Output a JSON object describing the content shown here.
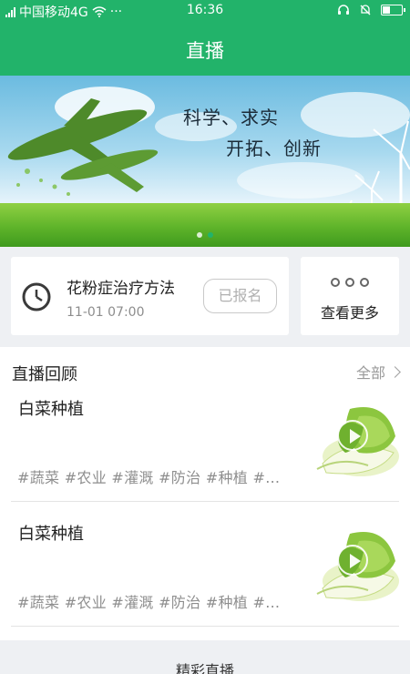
{
  "status_bar": {
    "carrier": "中国移动4G",
    "extra": "···",
    "time": "16:36"
  },
  "header": {
    "title": "直播"
  },
  "banner": {
    "line1": "科学、求实",
    "line2": "开拓、创新",
    "slides": 2,
    "active_slide": 2
  },
  "live": {
    "title": "花粉症治疗方法",
    "time": "11-01 07:00",
    "register_label": "已报名",
    "more_label": "查看更多"
  },
  "replay": {
    "title": "直播回顾",
    "all_label": "全部",
    "items": [
      {
        "title": "白菜种植",
        "tags": "#蔬菜 #农业 #灌溉 #防治 #种植 #…"
      },
      {
        "title": "白菜种植",
        "tags": "#蔬菜 #农业 #灌溉 #防治 #种植 #…"
      }
    ]
  },
  "bottom": {
    "title": "精彩直播"
  },
  "colors": {
    "accent": "#22b36a",
    "tag": "#8e8e8e"
  }
}
